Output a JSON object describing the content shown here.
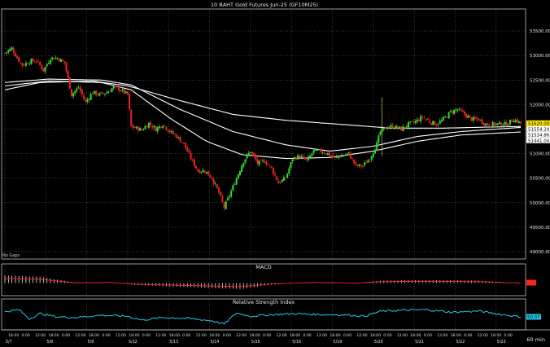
{
  "title": "10 BAHT  Gold Futures Jun-25 (GF10M25)",
  "no_gaps_label": "No Gaps",
  "timeframe_label": "60 min",
  "colors": {
    "background": "#000000",
    "grid": "#5a5a5a",
    "panel_border": "#bfbfbf",
    "up_candle": "#33dd33",
    "down_candle": "#ee2222",
    "moving_average": "#ffffff",
    "price_tag_bg": "#ffffff",
    "price_tag_text": "#000000",
    "last_price_tag_bg": "#ffe600",
    "macd_line": "#ff2222",
    "macd_histogram": "#ffffff",
    "rsi_line": "#22c9e8",
    "rsi_tag_bg": "#22c9e8"
  },
  "chart_data": [
    {
      "type": "candlestick",
      "title": "10 BAHT  Gold Futures Jun-25 (GF10M25)",
      "y_axis_position": "right",
      "yticks": [
        49000,
        49500,
        50000,
        50500,
        51000,
        51500,
        52000,
        52500,
        53000,
        53500
      ],
      "ylim": [
        48850,
        53950
      ],
      "grid": true,
      "date_markers": [
        "5/7",
        "5/8",
        "5/9",
        "5/12",
        "5/13",
        "5/14",
        "5/15",
        "5/16",
        "5/19",
        "5/20",
        "5/21",
        "5/22",
        "5/23"
      ],
      "time_labels": [
        "18:00",
        "0:00",
        "12:00",
        "18:00",
        "0:00",
        "12:00",
        "18:00",
        "0:00",
        "12:00",
        "18:00",
        "0:00",
        "12:00",
        "18:00",
        "0:00",
        "12:00",
        "18:00",
        "0:00",
        "12:00",
        "18:00",
        "0:00",
        "12:00",
        "18:00",
        "0:00",
        "12:00",
        "18:00",
        "0:00",
        "12:00",
        "18:00",
        "0:00",
        "12:00",
        "18:00",
        "0:00",
        "12:00",
        "18:00",
        "0:00",
        "12:00",
        "18:00",
        "0:00"
      ],
      "price_tags": [
        {
          "value": 51620.0,
          "label": "51620.00",
          "kind": "last"
        },
        {
          "value": 51554.24,
          "label": "51554.24",
          "kind": "ma"
        },
        {
          "value": 51534.86,
          "label": "51534.86",
          "kind": "ma"
        },
        {
          "value": 51441.04,
          "label": "51441.04",
          "kind": "ma"
        }
      ],
      "ohlc_anchor_closes": [
        [
          0,
          53050
        ],
        [
          4,
          53150
        ],
        [
          7,
          52950
        ],
        [
          10,
          52800
        ],
        [
          14,
          52880
        ],
        [
          18,
          52900
        ],
        [
          22,
          52700
        ],
        [
          26,
          52950
        ],
        [
          30,
          52950
        ],
        [
          34,
          52850
        ],
        [
          38,
          52200
        ],
        [
          42,
          52350
        ],
        [
          46,
          52050
        ],
        [
          50,
          52250
        ],
        [
          54,
          52200
        ],
        [
          58,
          52250
        ],
        [
          62,
          52350
        ],
        [
          66,
          52300
        ],
        [
          70,
          52200
        ],
        [
          72,
          51550
        ],
        [
          78,
          51480
        ],
        [
          82,
          51620
        ],
        [
          86,
          51500
        ],
        [
          90,
          51600
        ],
        [
          94,
          51450
        ],
        [
          98,
          51350
        ],
        [
          102,
          51200
        ],
        [
          106,
          50900
        ],
        [
          110,
          50650
        ],
        [
          114,
          50650
        ],
        [
          118,
          50500
        ],
        [
          122,
          50200
        ],
        [
          125,
          49900
        ],
        [
          128,
          50150
        ],
        [
          132,
          50500
        ],
        [
          136,
          50850
        ],
        [
          140,
          51050
        ],
        [
          144,
          50800
        ],
        [
          148,
          50850
        ],
        [
          152,
          50700
        ],
        [
          156,
          50400
        ],
        [
          160,
          50500
        ],
        [
          164,
          50900
        ],
        [
          168,
          50950
        ],
        [
          172,
          50850
        ],
        [
          176,
          51050
        ],
        [
          180,
          51050
        ],
        [
          184,
          51000
        ],
        [
          188,
          50900
        ],
        [
          192,
          50950
        ],
        [
          196,
          51000
        ],
        [
          200,
          50750
        ],
        [
          204,
          50750
        ],
        [
          208,
          50900
        ],
        [
          212,
          51200
        ],
        [
          214,
          51450
        ],
        [
          218,
          51550
        ],
        [
          222,
          51550
        ],
        [
          226,
          51500
        ],
        [
          230,
          51600
        ],
        [
          234,
          51650
        ],
        [
          238,
          51750
        ],
        [
          242,
          51650
        ],
        [
          246,
          51600
        ],
        [
          250,
          51700
        ],
        [
          254,
          51850
        ],
        [
          258,
          51900
        ],
        [
          262,
          51800
        ],
        [
          266,
          51700
        ],
        [
          270,
          51700
        ],
        [
          274,
          51600
        ],
        [
          278,
          51600
        ],
        [
          282,
          51600
        ],
        [
          286,
          51600
        ],
        [
          290,
          51700
        ],
        [
          294,
          51620
        ]
      ],
      "moving_averages": [
        {
          "name": "",
          "anchors": [
            [
              0,
              52300
            ],
            [
              20,
              52450
            ],
            [
              50,
              52480
            ],
            [
              70,
              52380
            ],
            [
              100,
              52080
            ],
            [
              130,
              51800
            ],
            [
              160,
              51680
            ],
            [
              190,
              51600
            ],
            [
              220,
              51520
            ],
            [
              250,
              51520
            ],
            [
              275,
              51540
            ],
            [
              294,
              51554.24
            ]
          ]
        },
        {
          "name": "",
          "anchors": [
            [
              0,
              52450
            ],
            [
              25,
              52520
            ],
            [
              55,
              52500
            ],
            [
              72,
              52400
            ],
            [
              100,
              51900
            ],
            [
              130,
              51450
            ],
            [
              160,
              51180
            ],
            [
              185,
              51050
            ],
            [
              210,
              51150
            ],
            [
              235,
              51350
            ],
            [
              260,
              51450
            ],
            [
              294,
              51534.86
            ]
          ]
        },
        {
          "name": "",
          "anchors": [
            [
              0,
              52380
            ],
            [
              25,
              52480
            ],
            [
              55,
              52450
            ],
            [
              72,
              52300
            ],
            [
              95,
              51700
            ],
            [
              115,
              51250
            ],
            [
              135,
              50980
            ],
            [
              160,
              50900
            ],
            [
              185,
              50920
            ],
            [
              210,
              51050
            ],
            [
              235,
              51250
            ],
            [
              260,
              51380
            ],
            [
              294,
              51441.04
            ]
          ]
        }
      ]
    },
    {
      "type": "line",
      "title": "MACD",
      "series_kinds": [
        "histogram",
        "line"
      ],
      "value_tag": "",
      "ylim": [
        -1,
        1
      ],
      "anchors": [
        [
          0,
          0.78
        ],
        [
          20,
          0.65
        ],
        [
          40,
          0.05
        ],
        [
          60,
          0.1
        ],
        [
          75,
          -0.2
        ],
        [
          95,
          -0.35
        ],
        [
          110,
          -0.45
        ],
        [
          125,
          -0.55
        ],
        [
          135,
          -0.6
        ],
        [
          150,
          -0.2
        ],
        [
          175,
          0.1
        ],
        [
          200,
          0.0
        ],
        [
          215,
          0.25
        ],
        [
          240,
          0.3
        ],
        [
          270,
          0.25
        ],
        [
          294,
          0.0
        ]
      ]
    },
    {
      "type": "line",
      "title": "Relative Strength Index",
      "value_tag": "50.07",
      "ylim": [
        0,
        100
      ],
      "anchors": [
        [
          0,
          66
        ],
        [
          8,
          72
        ],
        [
          14,
          44
        ],
        [
          20,
          60
        ],
        [
          30,
          50
        ],
        [
          40,
          48
        ],
        [
          55,
          55
        ],
        [
          70,
          52
        ],
        [
          78,
          40
        ],
        [
          90,
          48
        ],
        [
          105,
          45
        ],
        [
          118,
          38
        ],
        [
          125,
          28
        ],
        [
          132,
          62
        ],
        [
          140,
          52
        ],
        [
          150,
          56
        ],
        [
          165,
          60
        ],
        [
          180,
          57
        ],
        [
          195,
          56
        ],
        [
          205,
          52
        ],
        [
          214,
          67
        ],
        [
          225,
          70
        ],
        [
          240,
          72
        ],
        [
          255,
          64
        ],
        [
          270,
          68
        ],
        [
          282,
          58
        ],
        [
          288,
          54
        ],
        [
          294,
          50.07
        ]
      ]
    }
  ]
}
